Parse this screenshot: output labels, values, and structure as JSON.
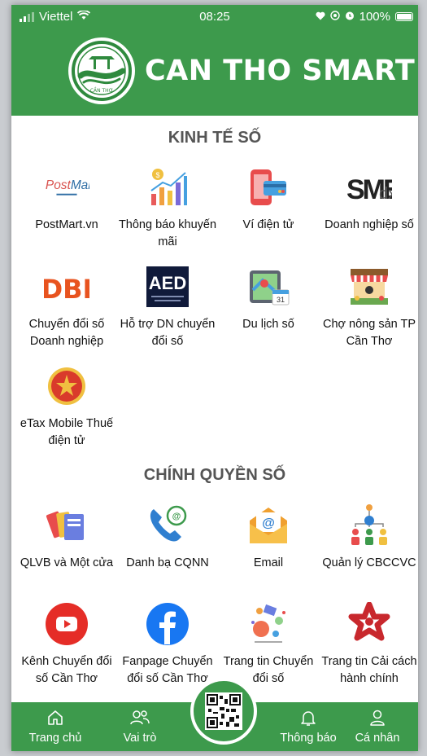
{
  "status_bar": {
    "carrier": "Viettel",
    "time": "08:25",
    "battery": "100%",
    "icons": [
      "signal-icon",
      "wifi-icon",
      "heart-icon",
      "location-icon",
      "alarm-icon",
      "battery-icon"
    ]
  },
  "header": {
    "title": "CAN THO SMART",
    "logo_caption": "CẦN THƠ"
  },
  "sections": {
    "kinh_te_so": {
      "title": "KINH TẾ SỐ",
      "items": [
        {
          "label": "PostMart.vn",
          "icon": "postmart-icon"
        },
        {
          "label": "Thông báo khuyến mãi",
          "icon": "promotion-chart-icon"
        },
        {
          "label": "Ví điện tử",
          "icon": "e-wallet-icon"
        },
        {
          "label": "Doanh nghiệp số",
          "icon": "smedx-icon"
        },
        {
          "label": "Chuyển đổi số Doanh nghiệp",
          "icon": "dbi-icon"
        },
        {
          "label": "Hỗ trợ DN chuyển đổi số",
          "icon": "aed-icon"
        },
        {
          "label": "Du lịch số",
          "icon": "travel-map-icon"
        },
        {
          "label": "Chợ nông sản TP Cần Thơ",
          "icon": "market-stall-icon"
        },
        {
          "label": "eTax Mobile Thuế điện tử",
          "icon": "etax-emblem-icon"
        }
      ]
    },
    "chinh_quyen_so": {
      "title": "CHÍNH QUYỀN SỐ",
      "items": [
        {
          "label": "QLVB và Một cửa",
          "icon": "documents-icon"
        },
        {
          "label": "Danh bạ CQNN",
          "icon": "phone-contacts-icon"
        },
        {
          "label": "Email",
          "icon": "email-icon"
        },
        {
          "label": "Quản lý CBCCVC",
          "icon": "org-chart-icon"
        },
        {
          "label": "Kênh Chuyển đổi số Cần Thơ",
          "icon": "youtube-icon"
        },
        {
          "label": "Fanpage Chuyển đổi số Cần Thơ",
          "icon": "facebook-icon"
        },
        {
          "label": "Trang tin Chuyển đổi số",
          "icon": "news-illustration-icon"
        },
        {
          "label": "Trang tin Cải cách hành chính",
          "icon": "reform-star-icon"
        }
      ]
    }
  },
  "bottom_nav": {
    "home": "Trang chủ",
    "roles": "Vai trò",
    "notifications": "Thông báo",
    "profile": "Cá nhân"
  },
  "colors": {
    "brand_green": "#3d9a4c",
    "section_title": "#555555"
  }
}
